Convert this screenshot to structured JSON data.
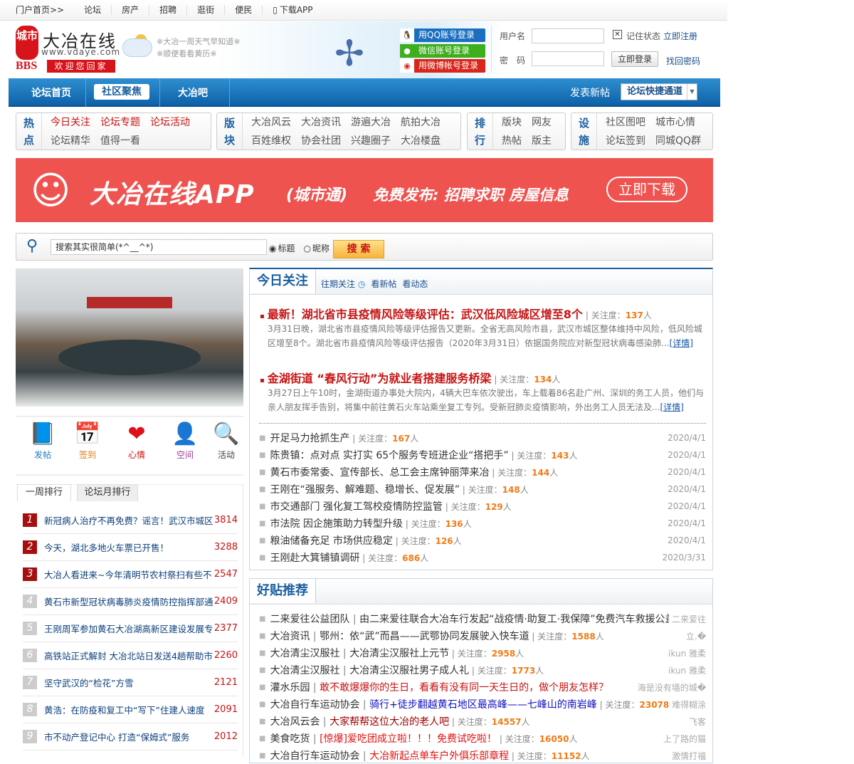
{
  "topbar": [
    "门户首页>>",
    "论坛",
    "房产",
    "招聘",
    "逛街",
    "便民",
    "下载APP"
  ],
  "logo": {
    "city": "城市",
    "name": "大冶在线",
    "url": "www.vdaye.com",
    "bbs": "BBS",
    "welcome": "欢迎您回家"
  },
  "weather": [
    "※大冶一周天气早知道※",
    "※顺便看看黄历※"
  ],
  "login": {
    "qq": "用QQ账号登录",
    "wechat": "微信账号登录",
    "weibo": "用微博帐号登录",
    "username_label": "用户名",
    "password_label": "密　码",
    "remember": "记住状态",
    "register": "立即注册",
    "submit": "立即登录",
    "forgot": "找回密码"
  },
  "nav": {
    "items": [
      "论坛首页",
      "社区聚焦",
      "大冶吧"
    ],
    "post": "发表新帖",
    "quick": "论坛快捷通道"
  },
  "quick": [
    {
      "head": [
        "热",
        "点"
      ],
      "links": [
        "今日关注",
        "论坛专题",
        "论坛活动",
        "论坛精华",
        "值得一看"
      ]
    },
    {
      "head": [
        "版",
        "块"
      ],
      "links": [
        "大冶风云",
        "大冶资讯",
        "游遍大冶",
        "航拍大冶",
        "百姓维权",
        "协会社团",
        "兴趣圈子",
        "大冶楼盘"
      ]
    },
    {
      "head": [
        "排",
        "行"
      ],
      "links": [
        "版块",
        "网友",
        "热帖",
        "版主"
      ]
    },
    {
      "head": [
        "设",
        "施"
      ],
      "links": [
        "社区图吧",
        "城市心情",
        "论坛签到",
        "同城QQ群"
      ]
    }
  ],
  "banner": {
    "title": "大冶在线APP",
    "sub": "(城市通)",
    "text": "免费发布: 招聘求职 房屋信息",
    "button": "立即下载"
  },
  "search": {
    "value": "搜索其实很简单(*^__^*)",
    "opt1": "标题",
    "opt2": "昵称",
    "button": "搜 索"
  },
  "icons": [
    {
      "label": "发帖",
      "color": "#1b7fc0"
    },
    {
      "label": "签到",
      "color": "#e07a12"
    },
    {
      "label": "心情",
      "color": "#c81313"
    },
    {
      "label": "空间",
      "color": "#a0449a"
    },
    {
      "label": "活动",
      "color": "#444444"
    }
  ],
  "rank": {
    "tabs": [
      "一周排行",
      "论坛月排行"
    ],
    "items": [
      {
        "n": "1",
        "t": "新冠病人治疗不再免费？谣言！武汉市城区",
        "c": "3814"
      },
      {
        "n": "2",
        "t": "今天，湖北多地火车票已开售！",
        "c": "3288"
      },
      {
        "n": "3",
        "t": "大冶人看进来~今年清明节农村祭扫有些不",
        "c": "2547"
      },
      {
        "n": "4",
        "t": "黄石市新型冠状病毒肺炎疫情防控指挥部通",
        "c": "2409"
      },
      {
        "n": "5",
        "t": "王刚周军参加黄石大冶湖高新区建设发展专",
        "c": "2377"
      },
      {
        "n": "6",
        "t": "高铁站正式解封 大冶北站日发送4趟帮助市",
        "c": "2260"
      },
      {
        "n": "7",
        "t": "坚守武汉的“检花”方雪",
        "c": "2121"
      },
      {
        "n": "8",
        "t": "黄浩：在防疫和复工中“写下”住建人速度",
        "c": "2091"
      },
      {
        "n": "9",
        "t": "市不动产登记中心 打造“保姆式”服务",
        "c": "2012"
      }
    ]
  },
  "today": {
    "title": "今日关注",
    "links": [
      "往期关注",
      "看新帖",
      "看动态"
    ],
    "meta_label": "关注度：",
    "unit": "人",
    "details": "[详情]",
    "headlines": [
      {
        "t": "最新！湖北省市县疫情风险等级评估：武汉低风险城区增至8个",
        "c": "137",
        "s": "3月31日晚，湖北省市县疫情风险等级评估报告又更新。全省无高风险市县，武汉市城区整体维持中风险，低风险城区增至8个。湖北省市县疫情风险等级评估报告（2020年3月31日）依据国务院应对新型冠状病毒感染肺..."
      },
      {
        "t": "金湖街道 “春风行动”为就业者搭建服务桥梁",
        "c": "134",
        "s": "3月27日上午10时，金湖街道办事处大院内，4辆大巴车依次驶出，车上载着86名赴广州、深圳的务工人员，他们与亲人朋友挥手告别，将集中前往黄石火车站乘坐复工专列。受新冠肺炎疫情影响，外出务工人员无法及..."
      }
    ],
    "items": [
      {
        "t": "开足马力抢抓生产",
        "c": "167",
        "d": "2020/4/1"
      },
      {
        "t": "陈贵镇：点对点 实打实 65个服务专班进企业“搭把手”",
        "c": "143",
        "d": "2020/4/1"
      },
      {
        "t": "黄石市委常委、宣传部长、总工会主席钟丽萍来冶",
        "c": "144",
        "d": "2020/4/1"
      },
      {
        "t": "王刚在“强服务、解难题、稳增长、促发展”",
        "c": "148",
        "d": "2020/4/1"
      },
      {
        "t": "市交通部门 强化复工驾校疫情防控监管",
        "c": "129",
        "d": "2020/4/1"
      },
      {
        "t": "市法院 因企施策助力转型升级",
        "c": "136",
        "d": "2020/4/1"
      },
      {
        "t": "粮油储备充足 市场供应稳定",
        "c": "126",
        "d": "2020/4/1"
      },
      {
        "t": "王刚赴大箕铺镇调研",
        "c": "686",
        "d": "2020/3/31"
      }
    ]
  },
  "good": {
    "title": "好贴推荐",
    "items": [
      {
        "f": "二来爱往公益团队",
        "t": "由二来爱往联合大冶车行发起“战疫情·助复工·我保障”免费汽车救援公益",
        "color": "#333333",
        "c": "",
        "u": "二来爱往"
      },
      {
        "f": "大冶资讯",
        "t": "鄂州：依“武”而昌——武鄂协同发展驶入快车道",
        "color": "#333333",
        "c": "1588",
        "u": "立.�"
      },
      {
        "f": "大冶清尘汉服社",
        "t": "大冶清尘汉服社上元节",
        "color": "#333333",
        "c": "2958",
        "u": "ikun 雅柔"
      },
      {
        "f": "大冶清尘汉服社",
        "t": "大冶清尘汉服社男子成人礼",
        "color": "#333333",
        "c": "1773",
        "u": "ikun 雅柔"
      },
      {
        "f": "灌水乐园",
        "t": "敢不敢爆爆你的生日，看看有没有同一天生日的，做个朋友怎样？",
        "color": "#c81313",
        "c": "",
        "u": "海是没有墙的城�"
      },
      {
        "f": "大冶自行车运动协会",
        "t": "骑行+徒步翻越黄石地区最高峰——七峰山的南岩峰",
        "color": "#1010c0",
        "c": "23078",
        "u": "难得糊涂"
      },
      {
        "f": "大冶风云会",
        "t": "大家帮帮这位大冶的老人吧",
        "color": "#a00000",
        "c": "14557",
        "u": "飞客"
      },
      {
        "f": "美食吃货",
        "t": "[惊爆]爱吃团成立啦！！！免费试吃啦！",
        "color": "#e01010",
        "c": "16050",
        "u": "上了路的猫"
      },
      {
        "f": "大冶自行车运动协会",
        "t": "大冶新起点单车户外俱乐部章程",
        "color": "#e01010",
        "c": "11152",
        "u": "激情打福"
      }
    ]
  }
}
